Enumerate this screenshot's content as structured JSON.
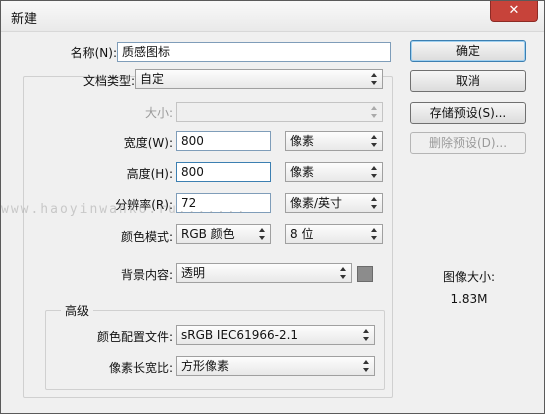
{
  "window": {
    "title": "新建",
    "close_glyph": "✕"
  },
  "form": {
    "name": {
      "label": "名称(N):",
      "value": "质感图标"
    },
    "preset": {
      "label": "文档类型:",
      "value": "自定"
    },
    "size": {
      "label": "大小:",
      "value": ""
    },
    "width": {
      "label": "宽度(W):",
      "value": "800",
      "unit": "像素"
    },
    "height": {
      "label": "高度(H):",
      "value": "800",
      "unit": "像素"
    },
    "resolution": {
      "label": "分辨率(R):",
      "value": "72",
      "unit": "像素/英寸"
    },
    "color_mode": {
      "label": "颜色模式:",
      "mode": "RGB 颜色",
      "depth": "8 位"
    },
    "background": {
      "label": "背景内容:",
      "value": "透明"
    },
    "advanced": {
      "title": "高级",
      "color_profile": {
        "label": "颜色配置文件:",
        "value": "sRGB IEC61966-2.1"
      },
      "pixel_aspect": {
        "label": "像素长宽比:",
        "value": "方形像素"
      }
    }
  },
  "buttons": {
    "ok": "确定",
    "cancel": "取消",
    "save_preset": "存储预设(S)...",
    "delete_preset": "删除预设(D)..."
  },
  "image_size": {
    "label": "图像大小:",
    "value": "1.83M"
  },
  "watermark": "www.haoyinwanko.ru.......",
  "colors": {
    "close_button": "#c7433a",
    "focus_border": "#3c7fb1",
    "swatch": "#8c8c8c"
  }
}
